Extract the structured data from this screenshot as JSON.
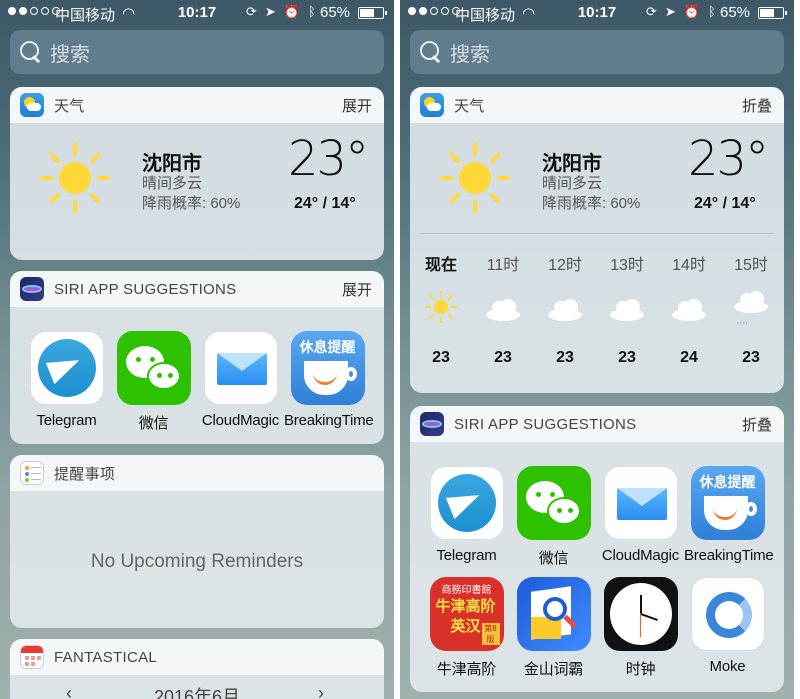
{
  "status": {
    "carrier": "中国移动",
    "time": "10:17",
    "battery": "65%",
    "battery_level": 0.65
  },
  "search": {
    "placeholder": "搜索"
  },
  "left": {
    "weather": {
      "title": "天气",
      "toggle": "展开",
      "city": "沈阳市",
      "condition": "晴间多云",
      "rain": "降雨概率: 60%",
      "temp": "23°",
      "hilo": "24° / 14°"
    },
    "siri": {
      "title": "SIRI APP SUGGESTIONS",
      "toggle": "展开",
      "apps": [
        "Telegram",
        "微信",
        "CloudMagic",
        "BreakingTime"
      ]
    },
    "reminders": {
      "title": "提醒事项",
      "empty": "No Upcoming Reminders"
    },
    "fantastical": {
      "title": "FANTASTICAL",
      "month": "2016年6月",
      "prev": "‹",
      "next": "›"
    }
  },
  "right": {
    "weather": {
      "title": "天气",
      "toggle": "折叠",
      "city": "沈阳市",
      "condition": "晴间多云",
      "rain": "降雨概率: 60%",
      "temp": "23°",
      "hilo": "24° / 14°",
      "hourly": [
        {
          "time": "现在",
          "icon": "sun-icon",
          "temp": "23"
        },
        {
          "time": "11时",
          "icon": "cloud-icon",
          "temp": "23"
        },
        {
          "time": "12时",
          "icon": "cloud-icon",
          "temp": "23"
        },
        {
          "time": "13时",
          "icon": "cloud-icon",
          "temp": "23"
        },
        {
          "time": "14时",
          "icon": "cloud-icon",
          "temp": "24"
        },
        {
          "time": "15时",
          "icon": "rain-cloud-icon",
          "temp": "23"
        }
      ]
    },
    "siri": {
      "title": "SIRI APP SUGGESTIONS",
      "toggle": "折叠",
      "apps": [
        "Telegram",
        "微信",
        "CloudMagic",
        "BreakingTime",
        "牛津高阶",
        "金山词霸",
        "时钟",
        "Moke"
      ]
    }
  },
  "icons": {
    "breakingtime_header": "休息提醒",
    "oxford_top": "商務印書館",
    "oxford_main_1": "牛津高阶",
    "oxford_main_2": "英汉",
    "oxford_stamp": "第8版"
  },
  "colors": {
    "sun": "#ffd93a",
    "wechat": "#2dc100",
    "telegram": "#1e8fcf",
    "oxford": "#d9302a",
    "jinshan": "#1e5cd8"
  }
}
